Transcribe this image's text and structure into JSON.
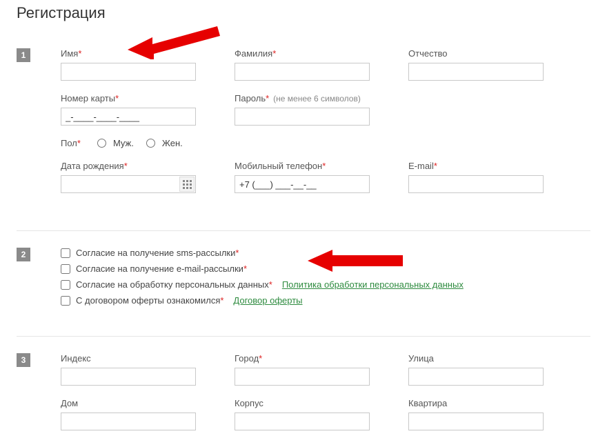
{
  "title": "Регистрация",
  "steps": {
    "s1": "1",
    "s2": "2",
    "s3": "3"
  },
  "fields": {
    "first_name": "Имя",
    "last_name": "Фамилия",
    "patronymic": "Отчество",
    "card_number": "Номер карты",
    "card_value": "_-____-____-____",
    "password": "Пароль",
    "password_hint": "(не менее 6 символов)",
    "gender": "Пол",
    "male": "Муж.",
    "female": "Жен.",
    "dob": "Дата рождения",
    "mobile": "Мобильный телефон",
    "mobile_value": "+7 (___) ___-__-__",
    "email": "E-mail",
    "index": "Индекс",
    "city": "Город",
    "street": "Улица",
    "house": "Дом",
    "building": "Корпус",
    "apartment": "Квартира"
  },
  "consents": {
    "sms": "Согласие на получение sms-рассылки",
    "email": "Согласие на получение e-mail-рассылки",
    "data": "Согласие на обработку персональных данных",
    "data_link": "Политика обработки персональных данных",
    "offer": "С договором оферты ознакомился",
    "offer_link": "Договор оферты"
  }
}
